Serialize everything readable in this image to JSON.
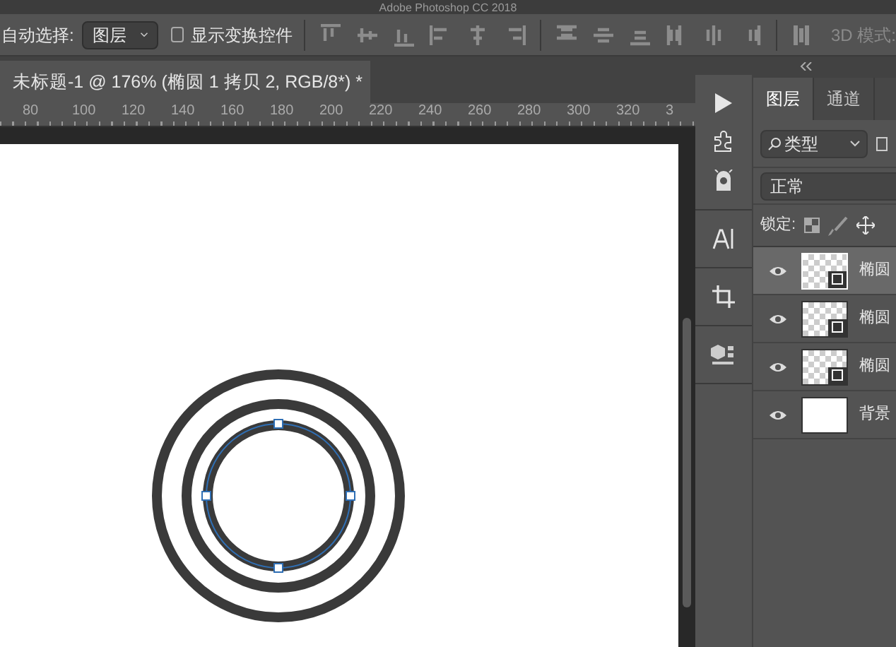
{
  "app_title": "Adobe Photoshop CC 2018",
  "options_bar": {
    "auto_select_label": "自动选择:",
    "auto_select_value": "图层",
    "show_transform": {
      "label": "显示变换控件",
      "checked": false
    },
    "mode_3d_label": "3D 模式:"
  },
  "document_tab": {
    "title": "未标题-1 @ 176% (椭圆 1 拷贝 2, RGB/8*) *"
  },
  "ruler": {
    "ticks": [
      "80",
      "100",
      "120",
      "140",
      "160",
      "180",
      "200",
      "220",
      "240",
      "260",
      "280",
      "300",
      "320",
      "3"
    ]
  },
  "layers_panel": {
    "tabs": [
      {
        "label": "图层",
        "selected": true
      },
      {
        "label": "通道",
        "selected": false
      }
    ],
    "filter": {
      "value": "类型"
    },
    "blend_mode": "正常",
    "lock_label": "锁定:",
    "layers": [
      {
        "name": "椭圆",
        "visible": true,
        "selected": true,
        "kind": "shape"
      },
      {
        "name": "椭圆",
        "visible": true,
        "selected": false,
        "kind": "shape"
      },
      {
        "name": "椭圆",
        "visible": true,
        "selected": false,
        "kind": "shape"
      },
      {
        "name": "背景",
        "visible": true,
        "selected": false,
        "kind": "fill"
      }
    ]
  }
}
